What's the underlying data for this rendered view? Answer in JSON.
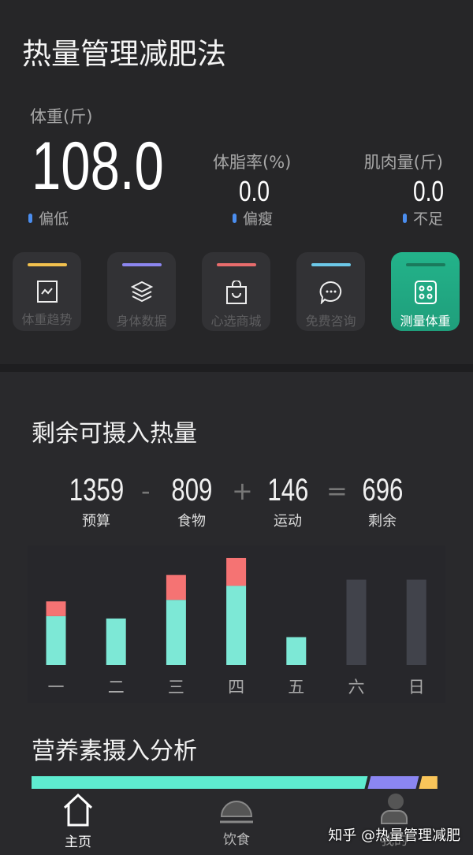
{
  "app": {
    "title": "热量管理减肥法"
  },
  "weight": {
    "label": "体重(斤)",
    "value": "108.0",
    "status": "偏低"
  },
  "fat": {
    "label": "体脂率(%)",
    "value": "0.0",
    "status": "偏瘦"
  },
  "muscle": {
    "label": "肌肉量(斤)",
    "value": "0.0",
    "status": "不足"
  },
  "actions": [
    {
      "label": "体重趋势",
      "icon": "trend-chart-icon",
      "color": "#f2c14e"
    },
    {
      "label": "身体数据",
      "icon": "layers-icon",
      "color": "#8c86f0"
    },
    {
      "label": "心选商城",
      "icon": "shopping-bag-icon",
      "color": "#e86c6c"
    },
    {
      "label": "免费咨询",
      "icon": "chat-bubble-icon",
      "color": "#6cc8e8"
    },
    {
      "label": "测量体重",
      "icon": "scale-icon",
      "color": "#1a7a5c",
      "active": true
    }
  ],
  "calories": {
    "title": "剩余可摄入热量",
    "budget": {
      "value": "1359",
      "label": "预算"
    },
    "food": {
      "value": "809",
      "label": "食物"
    },
    "exercise": {
      "value": "146",
      "label": "运动"
    },
    "remaining": {
      "value": "696",
      "label": "剩余"
    },
    "ops": [
      "-",
      "+",
      "="
    ]
  },
  "chart_data": {
    "type": "bar",
    "stacked": true,
    "categories": [
      "一",
      "二",
      "三",
      "四",
      "五",
      "六",
      "日"
    ],
    "series": [
      {
        "values": [
          63,
          60,
          84,
          102,
          36,
          0,
          0
        ],
        "color": "#7de8d6"
      },
      {
        "values": [
          19,
          0,
          32,
          36,
          0,
          0,
          0
        ],
        "color": "#f57373"
      },
      {
        "values": [
          0,
          0,
          0,
          0,
          0,
          110,
          110
        ],
        "color": "#41434b"
      }
    ],
    "ylim": [
      0,
      140
    ]
  },
  "nutrition": {
    "title": "营养素摄入分析",
    "segments": [
      {
        "fraction": 0.82,
        "color": "#5eecd0"
      },
      {
        "fraction": 0.125,
        "color": "#8b86f2"
      },
      {
        "fraction": 0.045,
        "color": "#f9c55a"
      }
    ]
  },
  "nav": [
    {
      "label": "主页",
      "icon": "home-icon"
    },
    {
      "label": "饮食",
      "icon": "food-cloche-icon"
    },
    {
      "label": "我的",
      "icon": "user-icon"
    }
  ],
  "watermark": "知乎 @热量管理减肥"
}
